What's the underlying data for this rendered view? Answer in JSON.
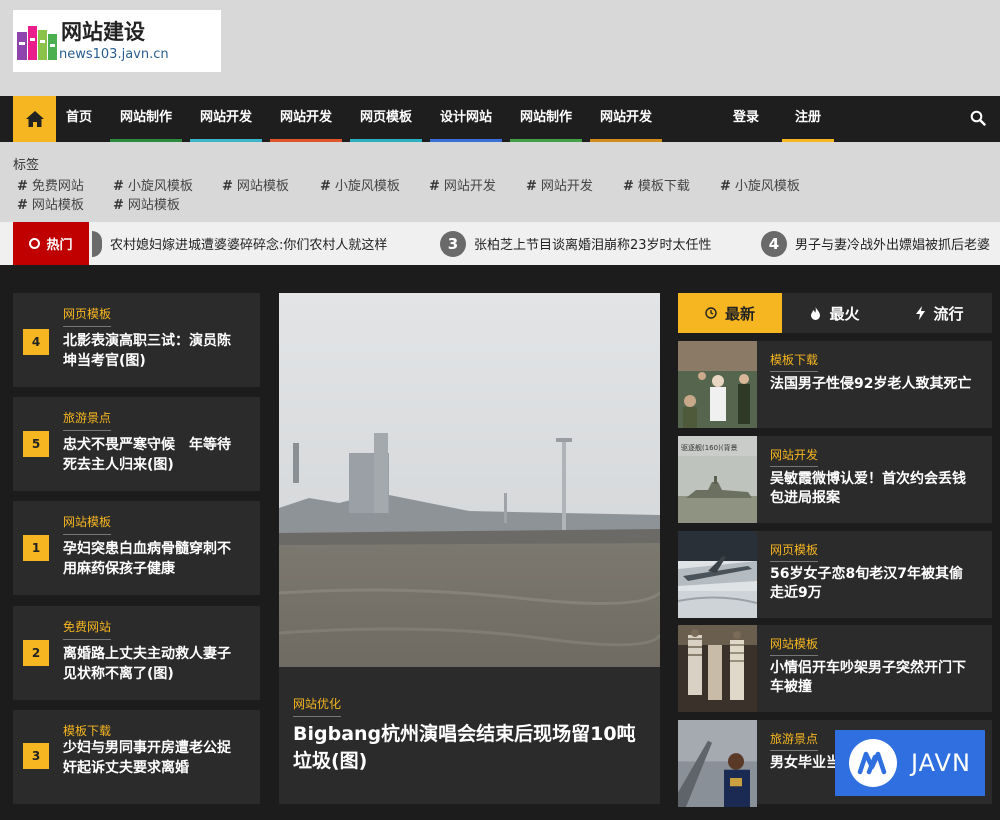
{
  "logo": {
    "title": "网站建设",
    "url": "news103.javn.cn"
  },
  "nav": {
    "items": [
      {
        "label": "首页",
        "color": "#f6b621"
      },
      {
        "label": "网站制作",
        "color": "#2b8a3e"
      },
      {
        "label": "网站开发",
        "color": "#3bb5c9"
      },
      {
        "label": "网站开发",
        "color": "#e0562a"
      },
      {
        "label": "网页模板",
        "color": "#2ab0c0"
      },
      {
        "label": "设计网站",
        "color": "#3b6fd8"
      },
      {
        "label": "网站制作",
        "color": "#43a047"
      },
      {
        "label": "网站开发",
        "color": "#d38c1c"
      },
      {
        "label": "登录",
        "color": ""
      },
      {
        "label": "注册",
        "color": "#f6b621"
      }
    ]
  },
  "tags": {
    "label": "标签",
    "items": [
      "免费网站",
      "小旋风模板",
      "网站模板",
      "小旋风模板",
      "网站开发",
      "网站开发",
      "模板下载",
      "小旋风模板",
      "网站模板",
      "网站模板"
    ]
  },
  "hot": {
    "label": "热门",
    "items": [
      {
        "num": "",
        "text": "农村媳妇嫁进城遭婆婆碎碎念:你们农村人就这样"
      },
      {
        "num": "3",
        "text": "张柏芝上节目谈离婚泪崩称23岁时太任性"
      },
      {
        "num": "4",
        "text": "男子与妻冷战外出嫖娼被抓后老婆"
      }
    ]
  },
  "left_list": [
    {
      "category": "网页模板",
      "rank": "4",
      "title": "北影表演高职三试：演员陈坤当考官(图)"
    },
    {
      "category": "旅游景点",
      "rank": "5",
      "title": "忠犬不畏严寒守候　年等待死去主人归来(图)"
    },
    {
      "category": "网站模板",
      "rank": "1",
      "title": "孕妇突患白血病骨髓穿刺不用麻药保孩子健康"
    },
    {
      "category": "免费网站",
      "rank": "2",
      "title": "离婚路上丈夫主动救人妻子见状称不离了(图)"
    },
    {
      "category": "模板下载",
      "rank": "3",
      "title": "少妇与男同事开房遭老公捉奸起诉丈夫要求离婚"
    }
  ],
  "feature": {
    "category": "网站优化",
    "title": "Bigbang杭州演唱会结束后现场留10吨垃圾(图)"
  },
  "right_tabs": [
    {
      "icon": "clock-icon",
      "label": "最新"
    },
    {
      "icon": "fire-icon",
      "label": "最火"
    },
    {
      "icon": "bolt-icon",
      "label": "流行"
    }
  ],
  "right_list": [
    {
      "category": "模板下载",
      "title": "法国男子性侵92岁老人致其死亡"
    },
    {
      "category": "网站开发",
      "title": "吴敏霞微博认爱！首次约会丢钱包进局报案",
      "thumb_caption": "驱逐舰(160)(背景"
    },
    {
      "category": "网页模板",
      "title": "56岁女子恋8旬老汉7年被其偷走近9万"
    },
    {
      "category": "网站模板",
      "title": "小情侣开车吵架男子突然开门下车被撞"
    },
    {
      "category": "旅游景点",
      "title": "男女毕业当晚确定"
    }
  ],
  "watermark": {
    "text": "JAVN"
  }
}
